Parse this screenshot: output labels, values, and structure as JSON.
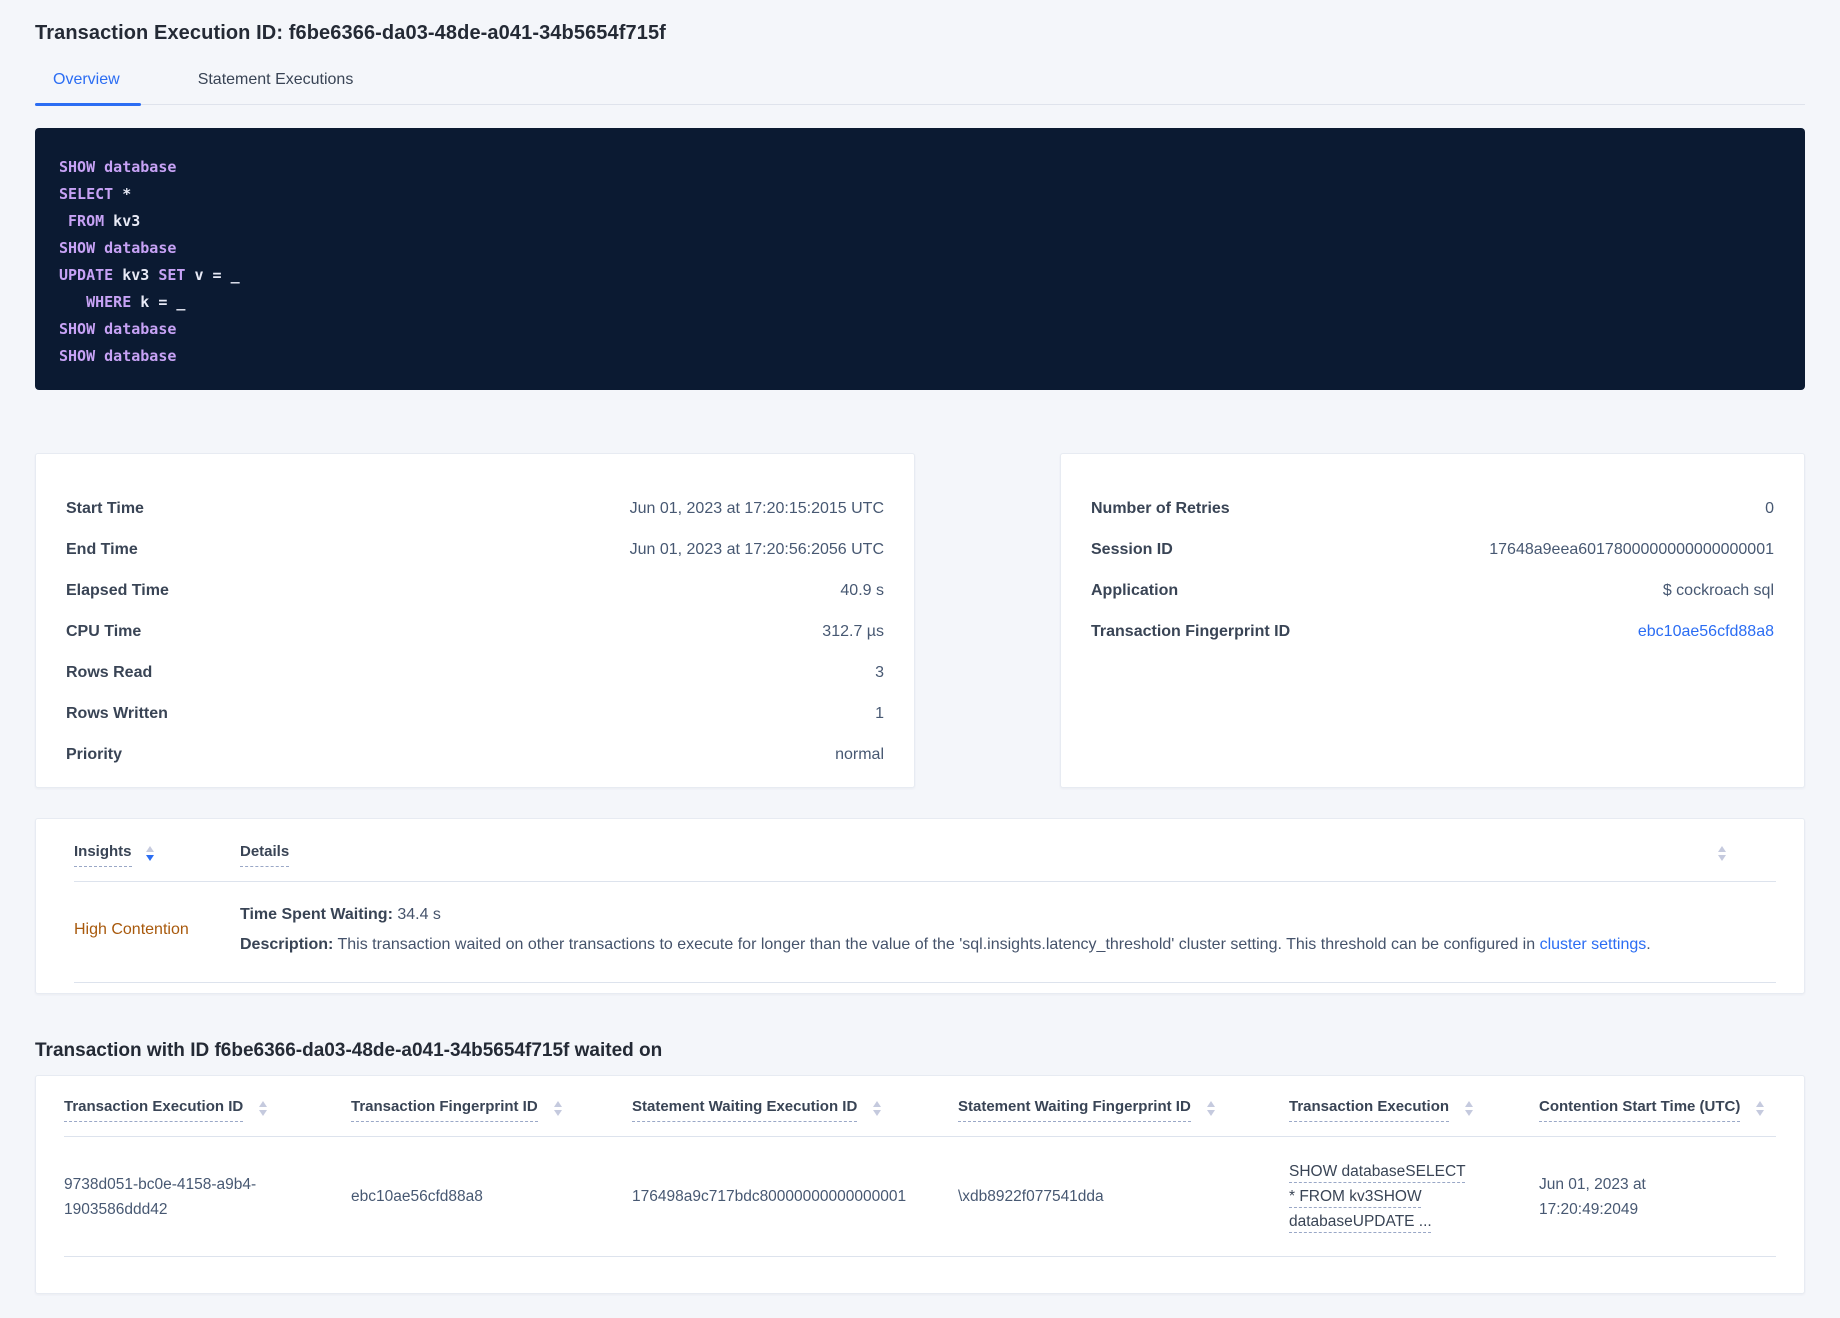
{
  "colors": {
    "accent": "#2b6df3",
    "warning_text": "#a8590c",
    "code_bg": "#0b1a32",
    "code_keyword": "#c7a2f5",
    "code_text": "#e8eaf6"
  },
  "header": {
    "title": "Transaction Execution ID: f6be6366-da03-48de-a041-34b5654f715f"
  },
  "tabs": [
    {
      "label": "Overview"
    },
    {
      "label": "Statement Executions"
    }
  ],
  "sql_box": {
    "lines": [
      [
        {
          "t": "SHOW database",
          "k": true
        }
      ],
      [
        {
          "t": "SELECT",
          "k": true
        },
        {
          "t": " *",
          "k": false
        }
      ],
      [
        {
          "t": " ",
          "k": false
        },
        {
          "t": "FROM",
          "k": true
        },
        {
          "t": " kv3",
          "k": false
        }
      ],
      [
        {
          "t": "SHOW database",
          "k": true
        }
      ],
      [
        {
          "t": "UPDATE",
          "k": true
        },
        {
          "t": " kv3 ",
          "k": false
        },
        {
          "t": "SET",
          "k": true
        },
        {
          "t": " v = _",
          "k": false
        }
      ],
      [
        {
          "t": "   ",
          "k": false
        },
        {
          "t": "WHERE",
          "k": true
        },
        {
          "t": " k = _",
          "k": false
        }
      ],
      [
        {
          "t": "SHOW database",
          "k": true
        }
      ],
      [
        {
          "t": "SHOW database",
          "k": true
        }
      ]
    ]
  },
  "summary_left": {
    "rows": [
      {
        "label": "Start Time",
        "value": "Jun 01, 2023 at 17:20:15:2015 UTC"
      },
      {
        "label": "End Time",
        "value": "Jun 01, 2023 at 17:20:56:2056 UTC"
      },
      {
        "label": "Elapsed Time",
        "value": "40.9 s"
      },
      {
        "label": "CPU Time",
        "value": "312.7 µs"
      },
      {
        "label": "Rows Read",
        "value": "3"
      },
      {
        "label": "Rows Written",
        "value": "1"
      },
      {
        "label": "Priority",
        "value": "normal"
      }
    ]
  },
  "summary_right": {
    "rows": [
      {
        "label": "Number of Retries",
        "value": "0"
      },
      {
        "label": "Session ID",
        "value": "17648a9eea6017800000000000000001"
      },
      {
        "label": "Application",
        "value": "$ cockroach sql"
      },
      {
        "label": "Transaction Fingerprint ID",
        "value": "ebc10ae56cfd88a8",
        "link": true
      }
    ]
  },
  "insights": {
    "col_insights": "Insights",
    "col_details": "Details",
    "row": {
      "insight": "High Contention",
      "waiting_label": "Time Spent Waiting:",
      "waiting_value": " 34.4 s",
      "description_label": "Description:",
      "description_text": " This transaction waited on other transactions to execute for longer than the value of the 'sql.insights.latency_threshold' cluster setting. This threshold can be configured in ",
      "description_link": "cluster settings",
      "description_suffix": "."
    }
  },
  "waited_on": {
    "heading": "Transaction with ID f6be6366-da03-48de-a041-34b5654f715f waited on",
    "columns": [
      "Transaction Execution ID",
      "Transaction Fingerprint ID",
      "Statement Waiting Execution ID",
      "Statement Waiting Fingerprint ID",
      "Transaction Execution",
      "Contention Start Time (UTC)"
    ],
    "row": {
      "transaction_execution_id": "9738d051-bc0e-4158-a9b4-1903586ddd42",
      "transaction_fingerprint_id": "ebc10ae56cfd88a8",
      "statement_waiting_execution_id": "176498a9c717bdc80000000000000001",
      "statement_waiting_fingerprint_id": "\\xdb8922f077541dda",
      "transaction_execution": "SHOW databaseSELECT * FROM kv3SHOW databaseUPDATE ...",
      "contention_start_time": "Jun 01, 2023 at 17:20:49:2049"
    }
  }
}
